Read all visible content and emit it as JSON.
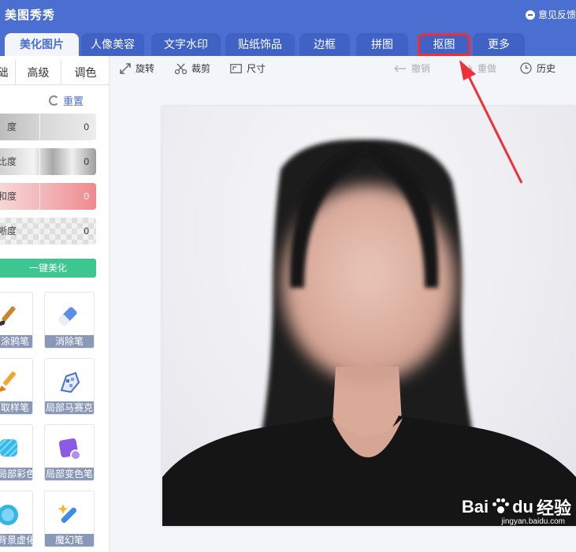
{
  "app": {
    "title": "美图秀秀",
    "feedback_label": "意见反馈"
  },
  "tabs": [
    {
      "label": "美化图片",
      "active": true
    },
    {
      "label": "人像美容"
    },
    {
      "label": "文字水印"
    },
    {
      "label": "贴纸饰品"
    },
    {
      "label": "边框"
    },
    {
      "label": "拼图"
    },
    {
      "label": "抠图",
      "highlighted": true
    },
    {
      "label": "更多"
    }
  ],
  "subtabs": [
    {
      "label": "础",
      "active": true
    },
    {
      "label": "高级"
    },
    {
      "label": "调色"
    }
  ],
  "panel": {
    "reset_label": "重置",
    "sliders": [
      {
        "label": "度",
        "value": "0"
      },
      {
        "label": "比度",
        "value": "0"
      },
      {
        "label": "和度",
        "value": "0"
      },
      {
        "label": "晰度",
        "value": "0"
      }
    ],
    "one_key_label": "一键美化",
    "tools": [
      {
        "label": "涂鸦笔",
        "icon": "paintbrush-icon"
      },
      {
        "label": "消除笔",
        "icon": "eraser-icon"
      },
      {
        "label": "取样笔",
        "icon": "sample-brush-icon"
      },
      {
        "label": "局部马赛克",
        "icon": "mosaic-pen-icon"
      },
      {
        "label": "局部彩色笔",
        "icon": "color-pen-icon"
      },
      {
        "label": "局部变色笔",
        "icon": "recolor-pen-icon"
      },
      {
        "label": "背景虚化",
        "icon": "blur-icon"
      },
      {
        "label": "魔幻笔",
        "icon": "magic-pen-icon"
      }
    ]
  },
  "toolbar": {
    "rotate": "旋转",
    "crop": "裁剪",
    "size": "尺寸",
    "undo": "撤销",
    "redo": "重做",
    "history": "历史"
  },
  "watermark": {
    "brand_text": "Bai",
    "brand_text2": "du",
    "brand_cn": "经验",
    "sub": "jingyan.baidu.com"
  },
  "colors": {
    "primary": "#4a6fd0",
    "accent_green": "#3dc592",
    "highlight_red": "#ee2f35"
  }
}
